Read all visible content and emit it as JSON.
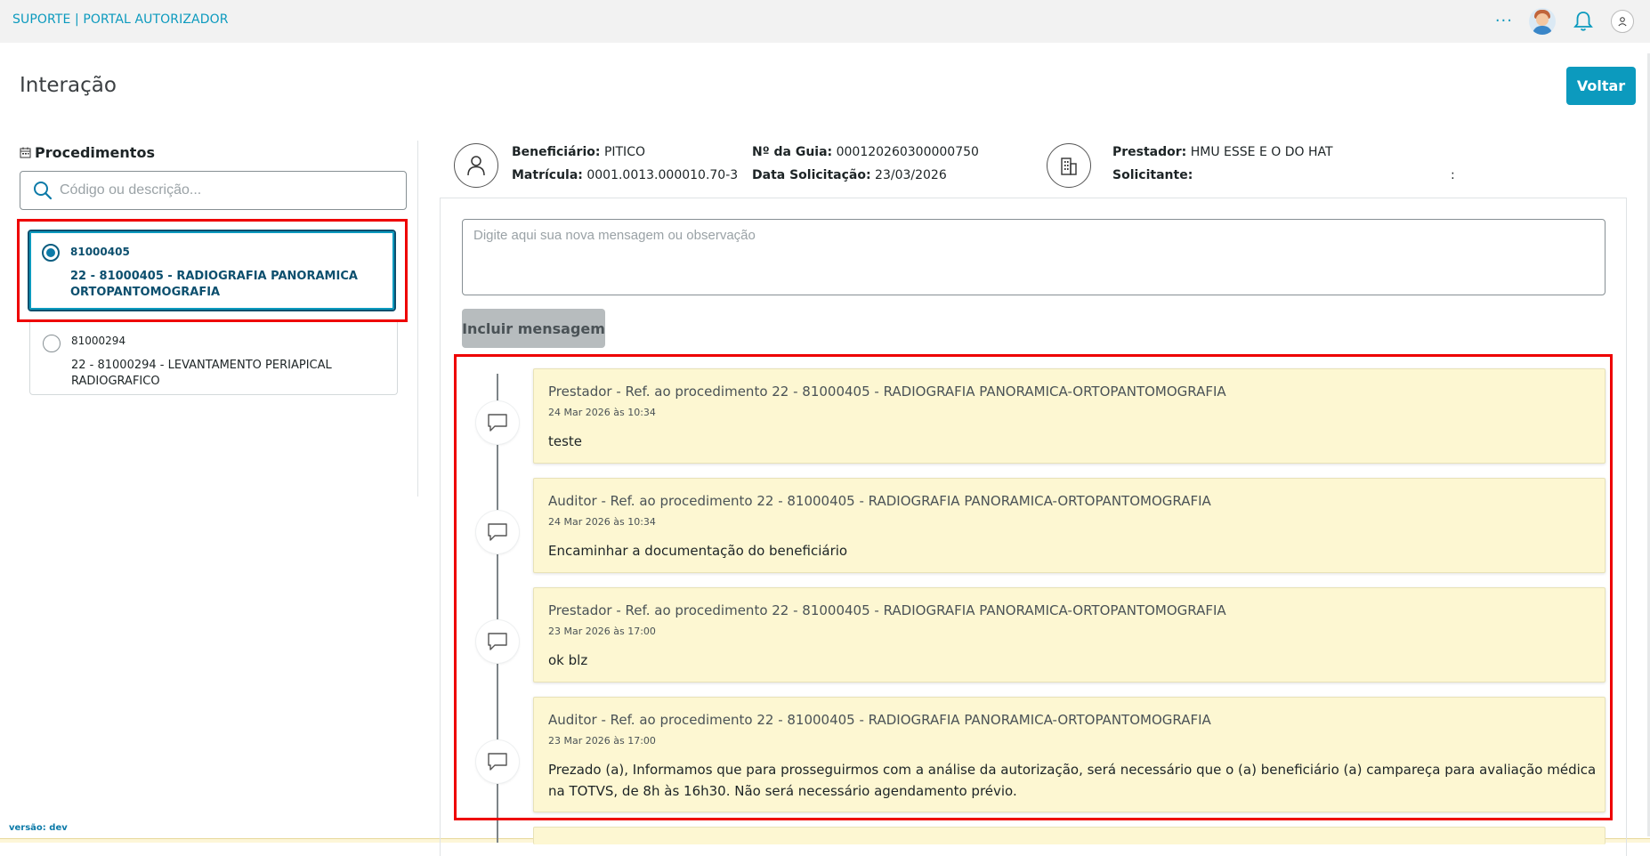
{
  "app": {
    "title": "SUPORTE | PORTAL AUTORIZADOR"
  },
  "page": {
    "title": "Interação",
    "back_label": "Voltar",
    "version": "versão: dev"
  },
  "procedures": {
    "title": "Procedimentos",
    "search_placeholder": "Código ou descrição...",
    "items": [
      {
        "code": "81000405",
        "description": "22 - 81000405 - RADIOGRAFIA PANORAMICA ORTOPANTOMOGRAFIA",
        "selected": true
      },
      {
        "code": "81000294",
        "description": "22 - 81000294 - LEVANTAMENTO PERIAPICAL RADIOGRAFICO",
        "selected": false
      }
    ]
  },
  "header": {
    "beneficiario_label": "Beneficiário:",
    "beneficiario_value": "PITICO",
    "matricula_label": "Matrícula:",
    "matricula_value": "0001.0013.000010.70-3",
    "guia_label": "Nº da Guia:",
    "guia_value": "000120260300000750",
    "data_label": "Data Solicitação:",
    "data_value": "23/03/2026",
    "prestador_label": "Prestador:",
    "prestador_value": "HMU ESSE E O DO HAT",
    "solicitante_label": "Solicitante:",
    "solicitante_value": ":"
  },
  "composer": {
    "placeholder": "Digite aqui sua nova mensagem ou observação",
    "button_label": "Incluir mensagem"
  },
  "messages": [
    {
      "title": "Prestador - Ref. ao procedimento 22 - 81000405 - RADIOGRAFIA PANORAMICA-ORTOPANTOMOGRAFIA",
      "date": "24 Mar 2026 às 10:34",
      "body": "teste"
    },
    {
      "title": "Auditor - Ref. ao procedimento 22 - 81000405 - RADIOGRAFIA PANORAMICA-ORTOPANTOMOGRAFIA",
      "date": "24 Mar 2026 às 10:34",
      "body": "Encaminhar a documentação do beneficiário"
    },
    {
      "title": "Prestador - Ref. ao procedimento 22 - 81000405 - RADIOGRAFIA PANORAMICA-ORTOPANTOMOGRAFIA",
      "date": "23 Mar 2026 às 17:00",
      "body": "ok blz"
    },
    {
      "title": "Auditor - Ref. ao procedimento 22 - 81000405 - RADIOGRAFIA PANORAMICA-ORTOPANTOMOGRAFIA",
      "date": "23 Mar 2026 às 17:00",
      "body": "Prezado (a), Informamos que para prosseguirmos com a análise da autorização, será necessário que o (a) beneficiário (a) campareça para avaliação médica na TOTVS, de 8h às 16h30. Não será necessário agendamento prévio."
    }
  ],
  "icons": {
    "brand_color": "#0c9abe",
    "highlight_color": "#ee0000",
    "message_bg": "#fdf7d2"
  }
}
